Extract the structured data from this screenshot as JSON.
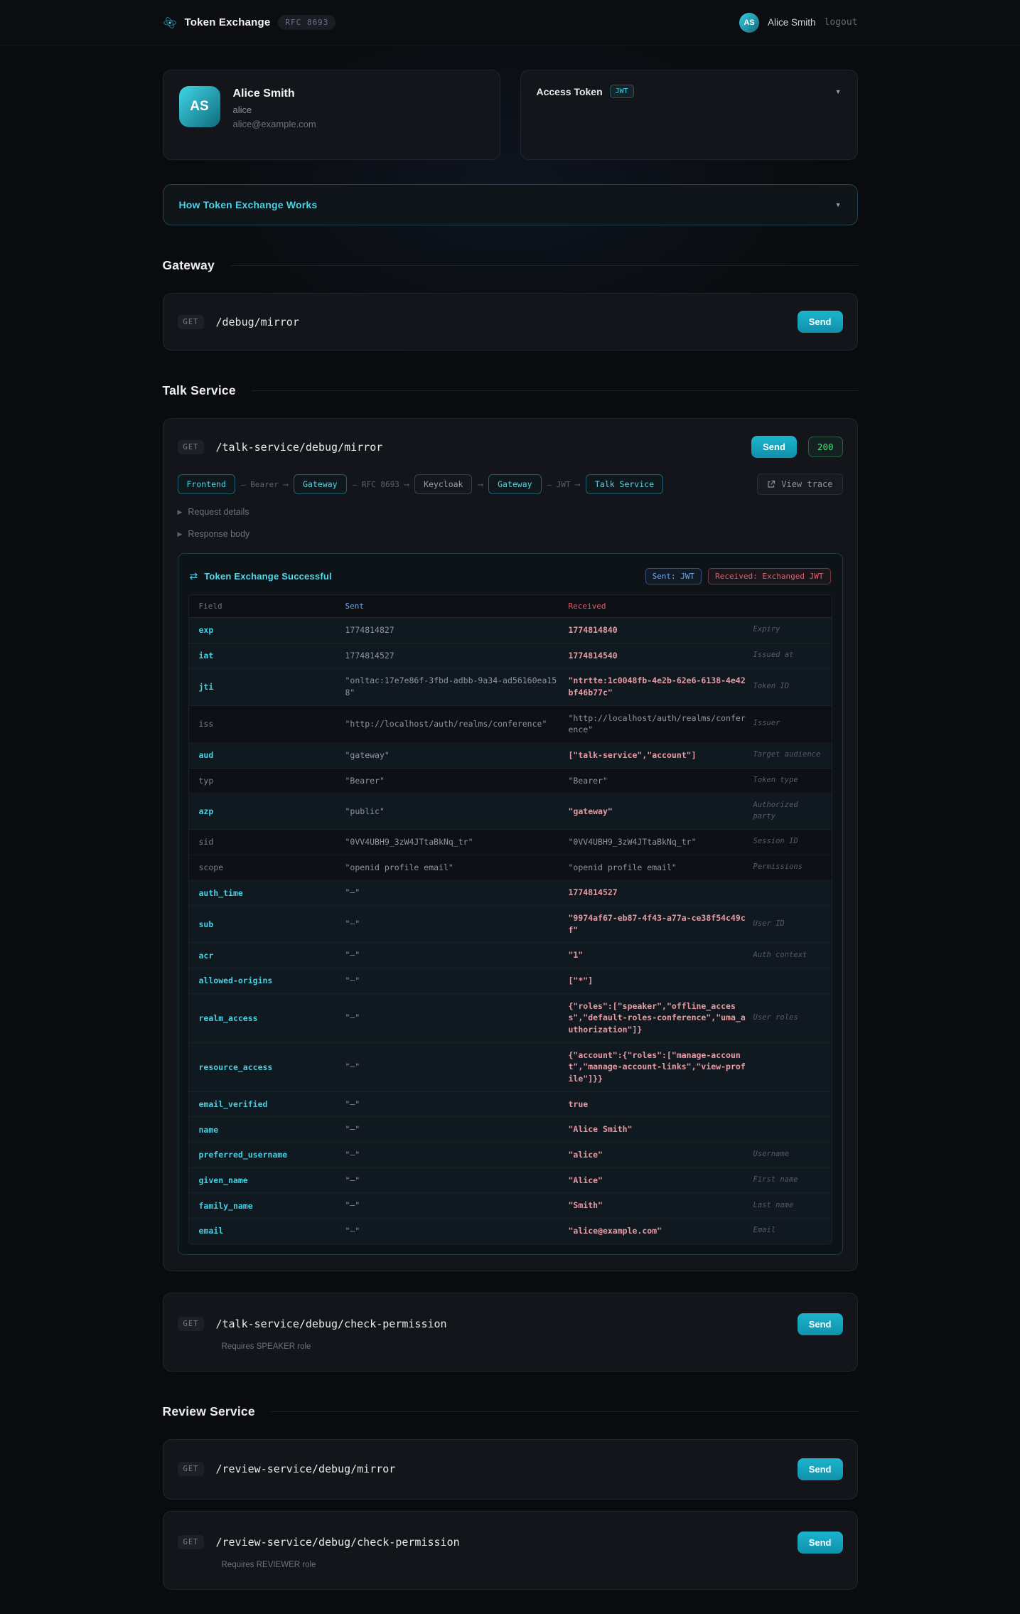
{
  "colors": {
    "accent_teal": "#1cb4cd",
    "cyan_text": "#4fd0e2",
    "sent_blue": "#6ea8e8",
    "received_red": "#e0606c",
    "status_green": "#4ade80"
  },
  "header": {
    "app_title": "Token Exchange",
    "rfc_badge": "RFC 8693",
    "user_initials": "AS",
    "user_name": "Alice Smith",
    "logout_label": "logout"
  },
  "user_card": {
    "initials": "AS",
    "name": "Alice Smith",
    "username": "alice",
    "email": "alice@example.com"
  },
  "token_card": {
    "title": "Access Token",
    "badge": "JWT"
  },
  "how_it_works": {
    "title": "How Token Exchange Works"
  },
  "sections": {
    "gateway": {
      "title": "Gateway"
    },
    "talk": {
      "title": "Talk Service"
    },
    "review": {
      "title": "Review Service"
    }
  },
  "endpoints": {
    "gateway_mirror": {
      "method": "GET",
      "path": "/debug/mirror",
      "send_label": "Send"
    },
    "talk_mirror": {
      "method": "GET",
      "path": "/talk-service/debug/mirror",
      "send_label": "Send",
      "status": "200"
    },
    "talk_check": {
      "method": "GET",
      "path": "/talk-service/debug/check-permission",
      "send_label": "Send",
      "note": "Requires SPEAKER role"
    },
    "review_mirror": {
      "method": "GET",
      "path": "/review-service/debug/mirror",
      "send_label": "Send"
    },
    "review_check": {
      "method": "GET",
      "path": "/review-service/debug/check-permission",
      "send_label": "Send",
      "note": "Requires REVIEWER role"
    }
  },
  "flow": {
    "view_trace_label": "View trace",
    "items": [
      {
        "type": "node",
        "label": "Frontend",
        "accent": true
      },
      {
        "type": "arrow",
        "label": "Bearer"
      },
      {
        "type": "node",
        "label": "Gateway",
        "accent": true
      },
      {
        "type": "arrow",
        "label": "RFC 8693"
      },
      {
        "type": "node",
        "label": "Keycloak",
        "accent": false
      },
      {
        "type": "arrow",
        "label": ""
      },
      {
        "type": "node",
        "label": "Gateway",
        "accent": true
      },
      {
        "type": "arrow",
        "label": "JWT"
      },
      {
        "type": "node",
        "label": "Talk Service",
        "accent": true
      }
    ]
  },
  "collapsibles": {
    "request_details": "Request details",
    "response_body": "Response body"
  },
  "exchange_panel": {
    "title": "Token Exchange Successful",
    "sent_badge": "Sent: JWT",
    "received_badge": "Received: Exchanged JWT",
    "columns": [
      "Field",
      "Sent",
      "Received"
    ],
    "rows": [
      {
        "field": "exp",
        "sent": "1774814827",
        "received": "1774814840",
        "note": "Expiry",
        "changed": true
      },
      {
        "field": "iat",
        "sent": "1774814527",
        "received": "1774814540",
        "note": "Issued at",
        "changed": true
      },
      {
        "field": "jti",
        "sent": "\"onltac:17e7e86f-3fbd-adbb-9a34-ad56160ea158\"",
        "received": "\"ntrtte:1c0048fb-4e2b-62e6-6138-4e42bf46b77c\"",
        "note": "Token ID",
        "changed": true
      },
      {
        "field": "iss",
        "sent": "\"http://localhost/auth/realms/conference\"",
        "received": "\"http://localhost/auth/realms/conference\"",
        "note": "Issuer",
        "changed": false
      },
      {
        "field": "aud",
        "sent": "\"gateway\"",
        "received": "[\"talk-service\",\"account\"]",
        "note": "Target audience",
        "changed": true
      },
      {
        "field": "typ",
        "sent": "\"Bearer\"",
        "received": "\"Bearer\"",
        "note": "Token type",
        "changed": false
      },
      {
        "field": "azp",
        "sent": "\"public\"",
        "received": "\"gateway\"",
        "note": "Authorized party",
        "changed": true
      },
      {
        "field": "sid",
        "sent": "\"0VV4UBH9_3zW4JTtaBkNq_tr\"",
        "received": "\"0VV4UBH9_3zW4JTtaBkNq_tr\"",
        "note": "Session ID",
        "changed": false
      },
      {
        "field": "scope",
        "sent": "\"openid profile email\"",
        "received": "\"openid profile email\"",
        "note": "Permissions",
        "changed": false
      },
      {
        "field": "auth_time",
        "sent": "\"–\"",
        "received": "1774814527",
        "note": "",
        "changed": true
      },
      {
        "field": "sub",
        "sent": "\"–\"",
        "received": "\"9974af67-eb87-4f43-a77a-ce38f54c49cf\"",
        "note": "User ID",
        "changed": true
      },
      {
        "field": "acr",
        "sent": "\"–\"",
        "received": "\"1\"",
        "note": "Auth context",
        "changed": true
      },
      {
        "field": "allowed-origins",
        "sent": "\"–\"",
        "received": "[\"*\"]",
        "note": "",
        "changed": true
      },
      {
        "field": "realm_access",
        "sent": "\"–\"",
        "received": "{\"roles\":[\"speaker\",\"offline_access\",\"default-roles-conference\",\"uma_authorization\"]}",
        "note": "User roles",
        "changed": true
      },
      {
        "field": "resource_access",
        "sent": "\"–\"",
        "received": "{\"account\":{\"roles\":[\"manage-account\",\"manage-account-links\",\"view-profile\"]}}",
        "note": "",
        "changed": true
      },
      {
        "field": "email_verified",
        "sent": "\"–\"",
        "received": "true",
        "note": "",
        "changed": true
      },
      {
        "field": "name",
        "sent": "\"–\"",
        "received": "\"Alice Smith\"",
        "note": "",
        "changed": true
      },
      {
        "field": "preferred_username",
        "sent": "\"–\"",
        "received": "\"alice\"",
        "note": "Username",
        "changed": true
      },
      {
        "field": "given_name",
        "sent": "\"–\"",
        "received": "\"Alice\"",
        "note": "First name",
        "changed": true
      },
      {
        "field": "family_name",
        "sent": "\"–\"",
        "received": "\"Smith\"",
        "note": "Last name",
        "changed": true
      },
      {
        "field": "email",
        "sent": "\"–\"",
        "received": "\"alice@example.com\"",
        "note": "Email",
        "changed": true
      }
    ]
  }
}
